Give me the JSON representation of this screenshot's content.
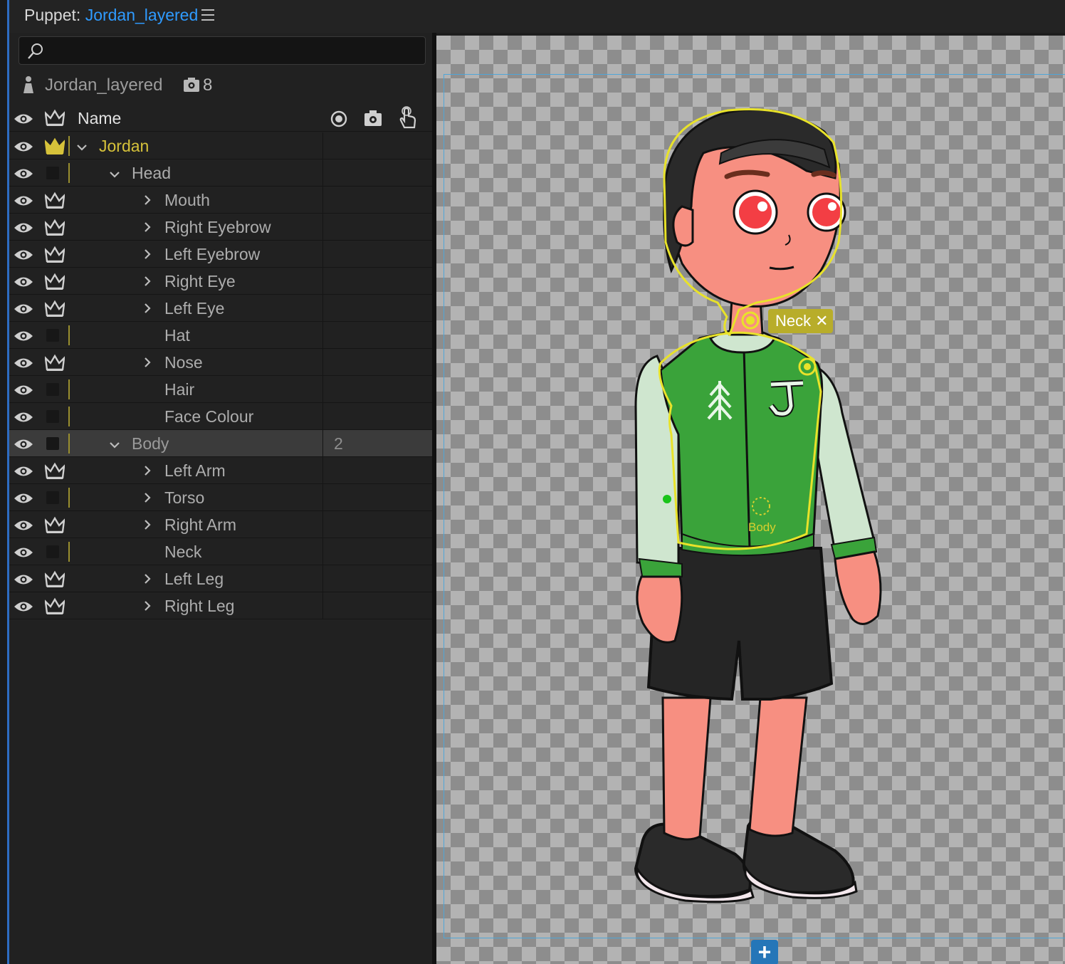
{
  "panel": {
    "title_prefix": "Puppet:",
    "title_link": "Jordan_layered"
  },
  "search": {
    "placeholder": ""
  },
  "puppet": {
    "name": "Jordan_layered",
    "camera_count": "8"
  },
  "columns": {
    "name": "Name"
  },
  "layers": [
    {
      "label": "Jordan",
      "depth": 0,
      "expanded": true,
      "crown": "gold",
      "extra": ""
    },
    {
      "label": "Head",
      "depth": 1,
      "expanded": true,
      "crown": "none",
      "extra": ""
    },
    {
      "label": "Mouth",
      "depth": 2,
      "expanded": false,
      "crown": "white",
      "extra": ""
    },
    {
      "label": "Right Eyebrow",
      "depth": 2,
      "expanded": false,
      "crown": "white",
      "extra": ""
    },
    {
      "label": "Left Eyebrow",
      "depth": 2,
      "expanded": false,
      "crown": "white",
      "extra": ""
    },
    {
      "label": "Right Eye",
      "depth": 2,
      "expanded": false,
      "crown": "white",
      "extra": ""
    },
    {
      "label": "Left Eye",
      "depth": 2,
      "expanded": false,
      "crown": "white",
      "extra": ""
    },
    {
      "label": "Hat",
      "depth": 2,
      "expanded": null,
      "crown": "none",
      "extra": ""
    },
    {
      "label": "Nose",
      "depth": 2,
      "expanded": false,
      "crown": "white",
      "extra": ""
    },
    {
      "label": "Hair",
      "depth": 2,
      "expanded": null,
      "crown": "none",
      "extra": ""
    },
    {
      "label": "Face Colour",
      "depth": 2,
      "expanded": null,
      "crown": "none",
      "extra": ""
    },
    {
      "label": "Body",
      "depth": 1,
      "expanded": true,
      "crown": "none",
      "extra": "2",
      "selected": true
    },
    {
      "label": "Left Arm",
      "depth": 2,
      "expanded": false,
      "crown": "white",
      "extra": ""
    },
    {
      "label": "Torso",
      "depth": 2,
      "expanded": false,
      "crown": "none",
      "extra": ""
    },
    {
      "label": "Right Arm",
      "depth": 2,
      "expanded": false,
      "crown": "white",
      "extra": ""
    },
    {
      "label": "Neck",
      "depth": 2,
      "expanded": null,
      "crown": "none",
      "extra": ""
    },
    {
      "label": "Left Leg",
      "depth": 2,
      "expanded": false,
      "crown": "white",
      "extra": ""
    },
    {
      "label": "Right Leg",
      "depth": 2,
      "expanded": false,
      "crown": "white",
      "extra": ""
    }
  ],
  "canvas": {
    "neck_tag": "Neck",
    "neck_close": "✕",
    "body_handle": "Body",
    "add_button": "+"
  },
  "colors": {
    "accent": "#2f9bff",
    "gold": "#d6c23a",
    "selection": "#e8e22a"
  }
}
